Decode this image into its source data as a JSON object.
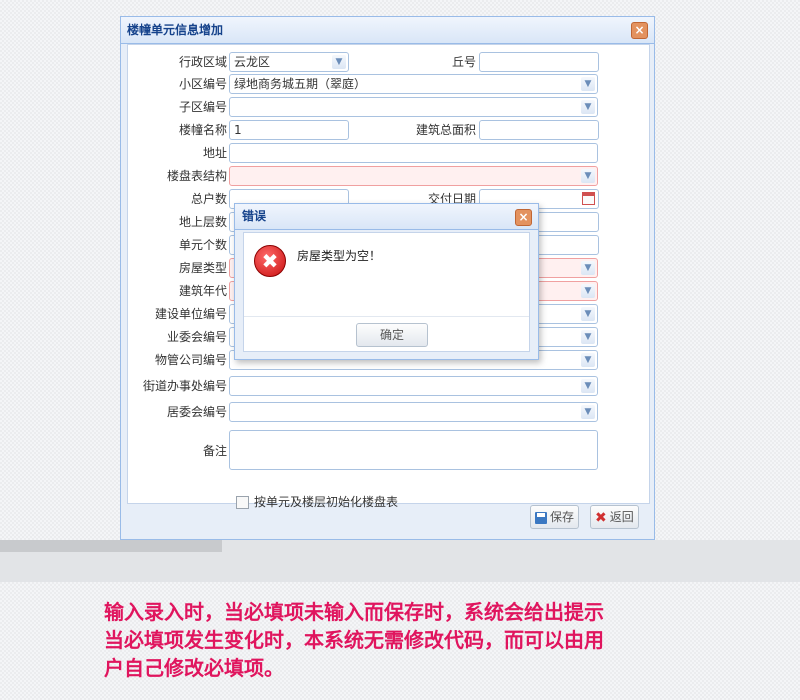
{
  "window": {
    "title": "楼幢单元信息增加",
    "close_glyph": "×"
  },
  "form": {
    "fields": [
      {
        "name": "district-select",
        "label": "行政区域",
        "value": "云龙区",
        "control": "select"
      },
      {
        "name": "hill-number-field",
        "label": "丘号",
        "value": "",
        "control": "text"
      },
      {
        "name": "community-code-select",
        "label": "小区编号",
        "value": "绿地商务城五期（翠庭）",
        "control": "select"
      },
      {
        "name": "sub-area-code-select",
        "label": "子区编号",
        "value": "",
        "control": "select"
      },
      {
        "name": "building-name-field",
        "label": "楼幢名称",
        "value": "1",
        "control": "text"
      },
      {
        "name": "total-floor-area-field",
        "label": "建筑总面积",
        "value": "",
        "control": "text"
      },
      {
        "name": "address-field",
        "label": "地址",
        "value": "",
        "control": "text"
      },
      {
        "name": "floor-plan-structure-select",
        "label": "楼盘表结构",
        "value": "",
        "control": "select",
        "required": true
      },
      {
        "name": "household-count-field",
        "label": "总户数",
        "value": "",
        "control": "text"
      },
      {
        "name": "delivery-date-field",
        "label": "交付日期",
        "value": "",
        "control": "date"
      },
      {
        "name": "above-ground-floors-field",
        "label": "地上层数",
        "value": "",
        "control": "text"
      },
      {
        "name": "unit-count-field",
        "label": "单元个数",
        "value": "",
        "control": "text"
      },
      {
        "name": "house-type-select",
        "label": "房屋类型",
        "value": "",
        "control": "select",
        "required": true
      },
      {
        "name": "build-year-select",
        "label": "建筑年代",
        "value": "",
        "control": "select",
        "required": true
      },
      {
        "name": "builder-code-select",
        "label": "建设单位编号",
        "value": "",
        "control": "select"
      },
      {
        "name": "owners-committee-code-select",
        "label": "业委会编号",
        "value": "",
        "control": "select"
      },
      {
        "name": "property-company-code-select",
        "label": "物管公司编号",
        "value": "",
        "control": "select"
      },
      {
        "name": "street-office-code-select",
        "label": "街道办事处编号",
        "value": "",
        "control": "select"
      },
      {
        "name": "residents-committee-code-select",
        "label": "居委会编号",
        "value": "",
        "control": "select"
      },
      {
        "name": "remarks-field",
        "label": "备注",
        "value": "",
        "control": "textarea"
      }
    ],
    "init_checkbox_label": "按单元及楼层初始化楼盘表",
    "select_arrow": "▼"
  },
  "footer": {
    "save_label": "保存",
    "back_label": "返回",
    "back_glyph": "✖"
  },
  "dialog": {
    "title": "错误",
    "icon_glyph": "✖",
    "message": "房屋类型为空！",
    "ok_label": "确定"
  },
  "note": {
    "lines": [
      "输入录入时，当必填项未输入而保存时，系统会给出提示",
      "当必填项发生变化时，本系统无需修改代码，而可以由用",
      "户自己修改必填项。"
    ]
  },
  "colors": {
    "required_bg": "#fff0f0",
    "note_text": "#e0155e",
    "window_border": "#99bbe8"
  }
}
